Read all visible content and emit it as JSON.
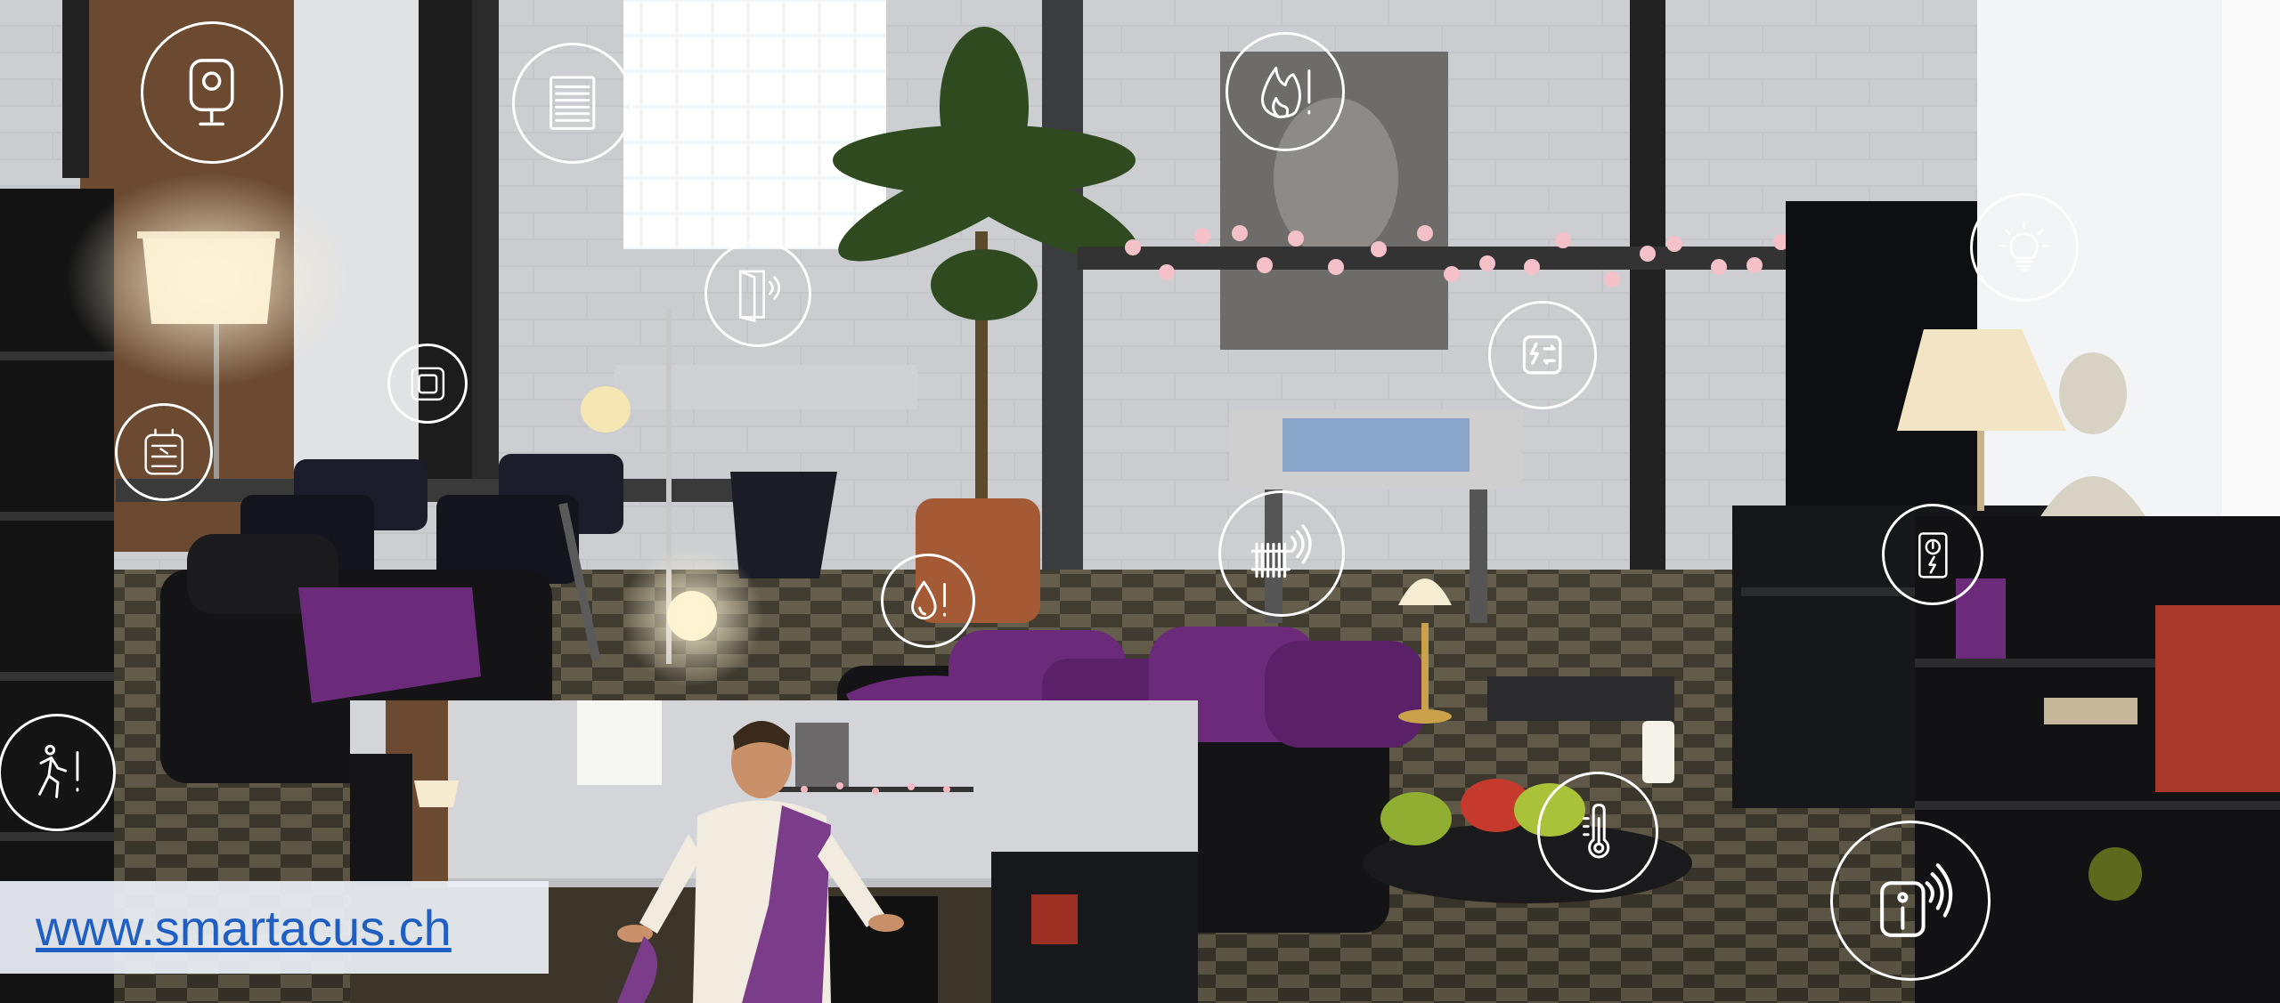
{
  "website": {
    "url_text": "www.smartacus.ch"
  },
  "overlay_icons": [
    {
      "name": "security-camera-icon"
    },
    {
      "name": "window-blinds-icon"
    },
    {
      "name": "door-sensor-icon"
    },
    {
      "name": "smoke-fire-alarm-icon"
    },
    {
      "name": "wall-switch-icon"
    },
    {
      "name": "smart-plug-icon"
    },
    {
      "name": "water-leak-alarm-icon"
    },
    {
      "name": "smart-radiator-icon"
    },
    {
      "name": "energy-switch-icon"
    },
    {
      "name": "smart-bulb-icon"
    },
    {
      "name": "energy-meter-icon"
    },
    {
      "name": "motion-alarm-icon"
    },
    {
      "name": "thermometer-icon"
    },
    {
      "name": "smart-hub-icon"
    }
  ],
  "colors": {
    "overlay_stroke": "#ffffff",
    "url_link": "#1f5fc4",
    "url_box": "#eef2f8",
    "accent_purple": "#6b2a7a"
  }
}
